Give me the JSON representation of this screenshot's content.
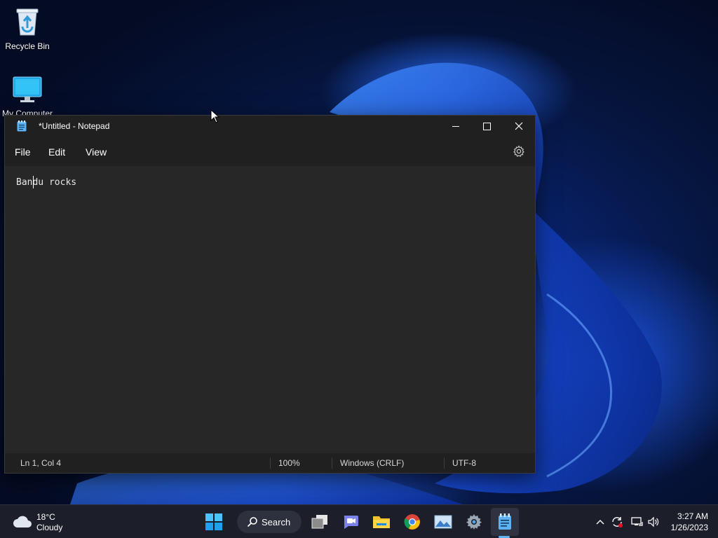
{
  "desktop": {
    "icons": [
      {
        "label": "Recycle Bin",
        "icon": "recycle-bin-icon"
      },
      {
        "label": "My Computer",
        "icon": "computer-icon"
      }
    ]
  },
  "notepad": {
    "title": "*Untitled - Notepad",
    "menu": [
      "File",
      "Edit",
      "View"
    ],
    "content": "Bandu rocks",
    "status": {
      "position": "Ln 1, Col 4",
      "zoom": "100%",
      "line_ending": "Windows (CRLF)",
      "encoding": "UTF-8"
    }
  },
  "taskbar": {
    "weather": {
      "temp": "18°C",
      "condition": "Cloudy"
    },
    "search_label": "Search",
    "apps": [
      "start-icon",
      "task-view-icon",
      "teams-chat-icon",
      "file-explorer-icon",
      "chrome-icon",
      "photos-icon",
      "settings-icon",
      "notepad-icon"
    ],
    "clock": {
      "time": "3:27 AM",
      "date": "1/26/2023"
    }
  },
  "colors": {
    "accent": "#5fb2f2",
    "window_bg": "#272727",
    "titlebar_bg": "#202020"
  }
}
